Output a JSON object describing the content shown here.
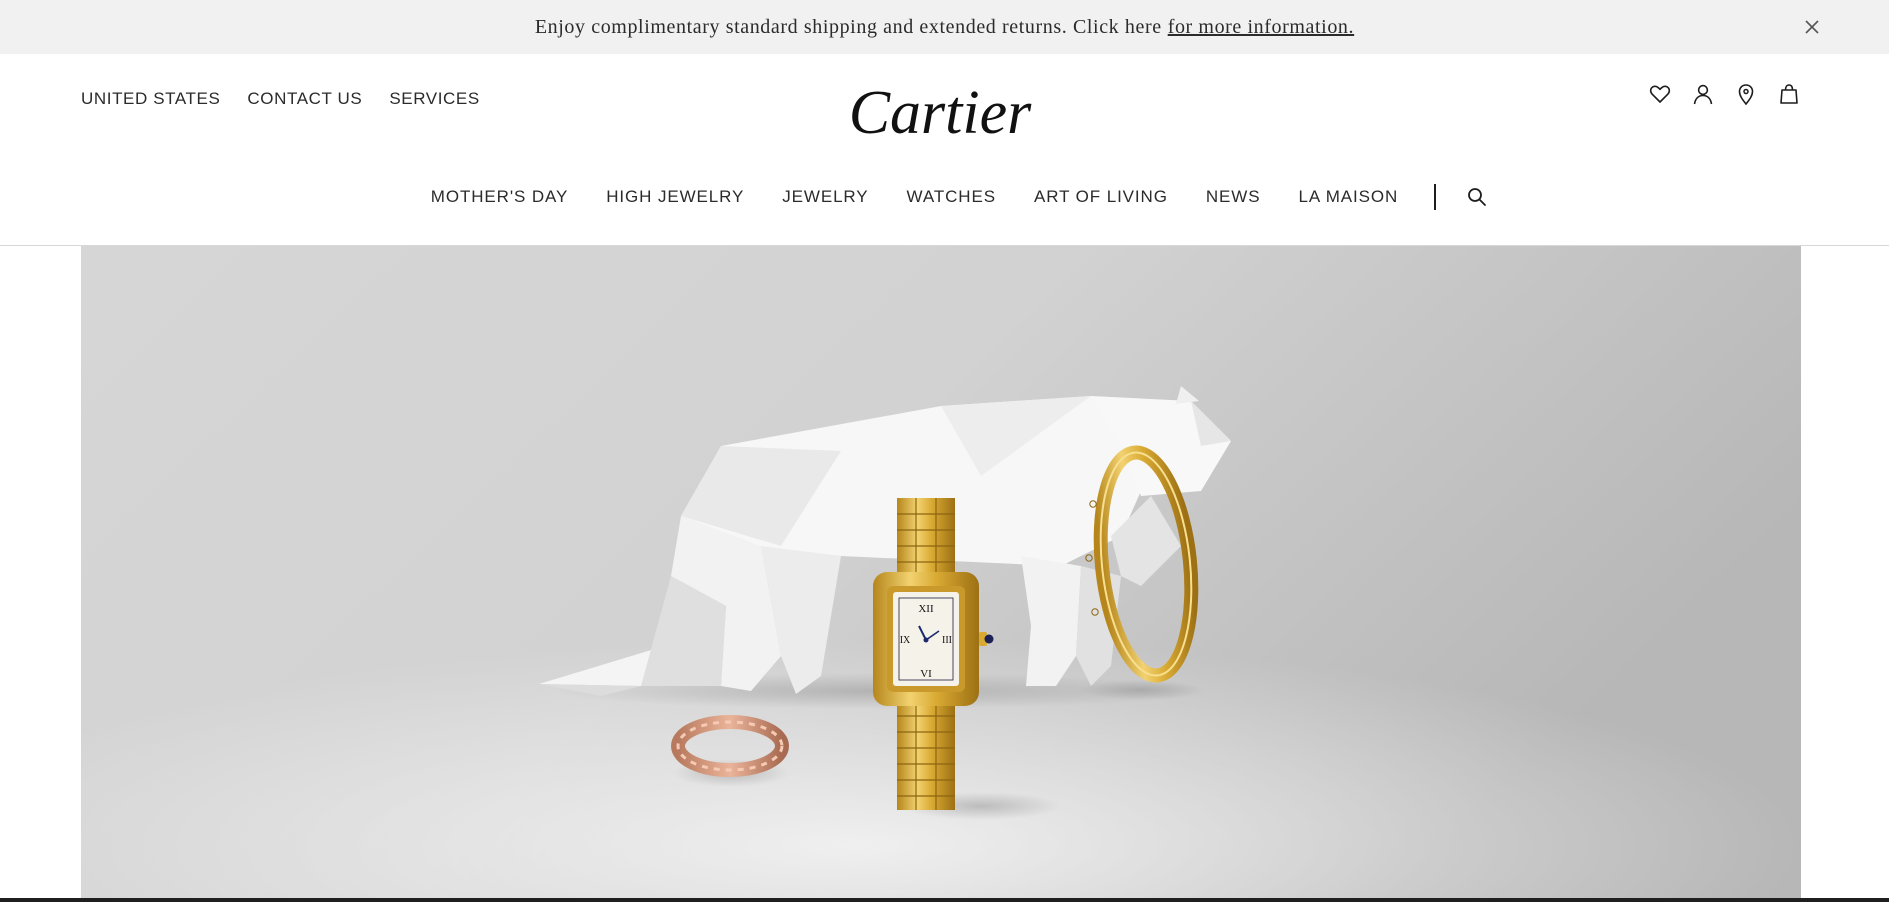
{
  "banner": {
    "text": "Enjoy complimentary standard shipping and extended returns. Click here",
    "link_text": "for more information.",
    "close_icon": "close-icon"
  },
  "header": {
    "utility_links": [
      "UNITED STATES",
      "CONTACT US",
      "SERVICES"
    ],
    "logo_text": "Cartier",
    "icons": [
      "heart-icon",
      "account-icon",
      "location-pin-icon",
      "shopping-bag-icon"
    ]
  },
  "nav": {
    "items": [
      "MOTHER'S DAY",
      "HIGH JEWELRY",
      "JEWELRY",
      "WATCHES",
      "ART OF LIVING",
      "NEWS",
      "LA MAISON"
    ],
    "search_icon": "search-icon"
  },
  "hero": {
    "watch_numerals": [
      "XII",
      "III",
      "VI",
      "IX"
    ]
  },
  "colors": {
    "banner_bg": "#f1f1f1",
    "text": "#2b2b2b",
    "gold": "#d4a832",
    "rose_gold": "#d49a7d",
    "hero_bg": "#cfcfcf"
  }
}
